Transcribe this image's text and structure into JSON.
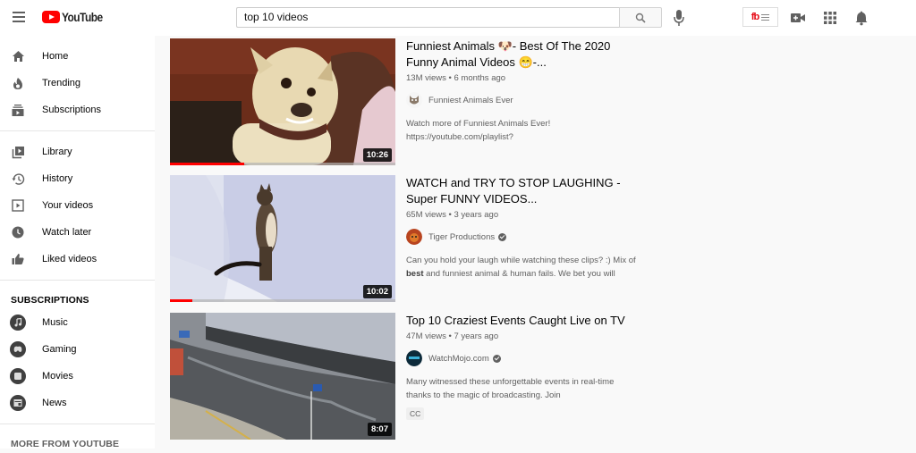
{
  "app": {
    "name": "YouTube"
  },
  "header": {
    "logo_text": "YouTube",
    "search_value": "top 10 videos",
    "extension_logo": "fb",
    "icons": [
      "search-icon",
      "mic-icon",
      "extension-icon",
      "create-video-icon",
      "apps-icon",
      "notifications-icon"
    ]
  },
  "sidebar": {
    "main": [
      {
        "label": "Home",
        "icon": "home-icon"
      },
      {
        "label": "Trending",
        "icon": "trending-icon"
      },
      {
        "label": "Subscriptions",
        "icon": "subscriptions-icon"
      }
    ],
    "library": [
      {
        "label": "Library",
        "icon": "library-icon"
      },
      {
        "label": "History",
        "icon": "history-icon"
      },
      {
        "label": "Your videos",
        "icon": "your-videos-icon"
      },
      {
        "label": "Watch later",
        "icon": "watch-later-icon"
      },
      {
        "label": "Liked videos",
        "icon": "liked-icon"
      }
    ],
    "subscriptions_title": "SUBSCRIPTIONS",
    "subscriptions": [
      {
        "label": "Music",
        "icon": "music-icon"
      },
      {
        "label": "Gaming",
        "icon": "gaming-icon"
      },
      {
        "label": "Movies",
        "icon": "movies-icon"
      },
      {
        "label": "News",
        "icon": "news-icon"
      }
    ],
    "more_title": "MORE FROM YOUTUBE"
  },
  "results": [
    {
      "title": "Funniest Animals 🐶- Best Of The 2020 Funny Animal Videos 😁-...",
      "views": "13M views",
      "age": "6 months ago",
      "meta": "13M views • 6 months ago",
      "channel": "Funniest Animals Ever",
      "verified": false,
      "description": "Watch more of Funniest Animals Ever! https://youtube.com/playlist?",
      "duration": "10:26",
      "watched_percent": 33,
      "badge": ""
    },
    {
      "title": "WATCH and TRY TO STOP LAUGHING - Super FUNNY VIDEOS...",
      "views": "65M views",
      "age": "3 years ago",
      "meta": "65M views • 3 years ago",
      "channel": "Tiger Productions",
      "verified": true,
      "description_parts": [
        "Can you hold your laugh while watching these clips? :) Mix of ",
        "best",
        " and funniest animal & human fails. We bet you will"
      ],
      "duration": "10:02",
      "watched_percent": 10,
      "badge": ""
    },
    {
      "title": "Top 10 Craziest Events Caught Live on TV",
      "views": "47M views",
      "age": "7 years ago",
      "meta": "47M views • 7 years ago",
      "channel": "WatchMojo.com",
      "verified": true,
      "description": "Many witnessed these unforgettable events in real-time thanks to the magic of broadcasting. Join",
      "duration": "8:07",
      "watched_percent": 0,
      "badge": "CC"
    }
  ],
  "colors": {
    "brand_red": "#ff0000",
    "background": "#f9f9f9",
    "text_secondary": "#606060"
  }
}
